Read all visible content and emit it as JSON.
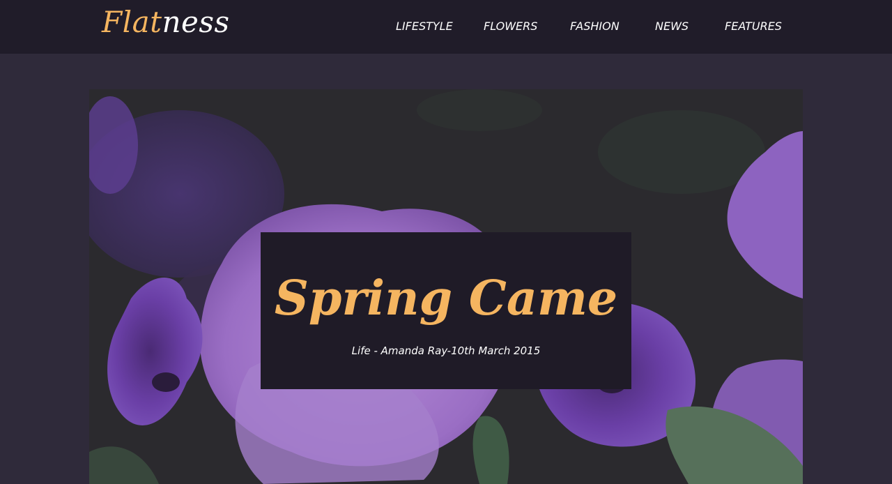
{
  "header": {
    "logo": {
      "part1": "Flat",
      "part2": "ness"
    },
    "nav": [
      {
        "label": "LIFESTYLE"
      },
      {
        "label": "FLOWERS"
      },
      {
        "label": "FASHION"
      },
      {
        "label": "NEWS"
      },
      {
        "label": "FEATURES"
      }
    ]
  },
  "hero": {
    "title": "Spring Came",
    "meta": "Life - Amanda Ray-10th March 2015"
  },
  "colors": {
    "header_bg": "#201c29",
    "page_bg": "#2f2a3a",
    "accent": "#f5b560",
    "card_bg": "#1f1b27"
  }
}
